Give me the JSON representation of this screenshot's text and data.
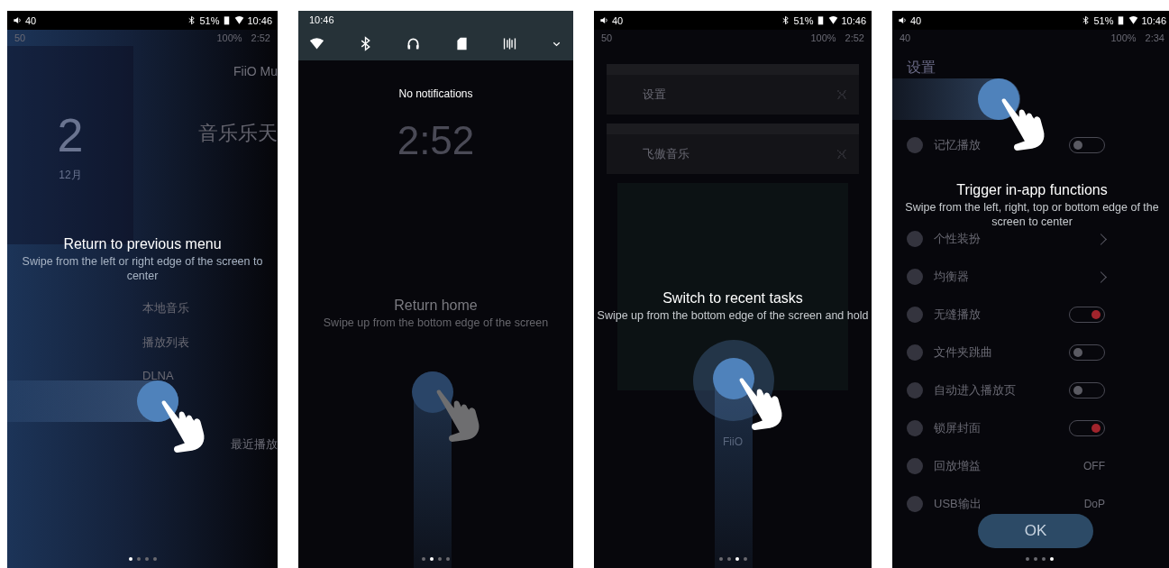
{
  "screens": [
    {
      "kind": "home",
      "status_bar": {
        "volume": "40",
        "battery": "51%",
        "time": "10:46"
      },
      "under_status": {
        "volume": "50",
        "battery": "100%",
        "time": "2:52"
      },
      "home": {
        "app_title": "FiiO Mu",
        "clock": "2",
        "date": "12月",
        "banner": "音乐乐天",
        "menu": [
          "本地音乐",
          "播放列表",
          "DLNA"
        ],
        "recent": "最近播放"
      },
      "hint": {
        "title": "Return to previous menu",
        "description": "Swipe from the left or right edge of the screen to center"
      },
      "gesture": {
        "kind": "swipe-horizontal"
      },
      "page_dots": [
        {
          "selected": true
        },
        {
          "selected": false
        },
        {
          "selected": false
        },
        {
          "selected": false
        }
      ]
    },
    {
      "kind": "notifications",
      "shade": {
        "time": "10:46",
        "toggles": [
          {
            "kind": "wifi"
          },
          {
            "kind": "bluetooth"
          },
          {
            "kind": "headphones"
          },
          {
            "kind": "sd-card"
          },
          {
            "kind": "bars"
          },
          {
            "kind": "expand"
          }
        ]
      },
      "message": "No notifications",
      "lock_clock": "2:52",
      "hint": {
        "title": "Return home",
        "description": "Swipe up from the bottom edge of the screen"
      },
      "gesture": {
        "kind": "swipe-up"
      },
      "page_dots": [
        {
          "selected": false
        },
        {
          "selected": true
        },
        {
          "selected": false
        },
        {
          "selected": false
        }
      ]
    },
    {
      "kind": "recents",
      "status_bar": {
        "volume": "40",
        "battery": "51%",
        "time": "10:46"
      },
      "under_status": {
        "volume": "50",
        "battery": "100%",
        "time": "2:52"
      },
      "tasks": [
        "设置",
        "飞傲音乐"
      ],
      "artist": "FiiO",
      "hint": {
        "title": "Switch to recent tasks",
        "description": "Swipe up from the bottom edge of the screen and hold"
      },
      "gesture": {
        "kind": "press-hold"
      },
      "page_dots": [
        {
          "selected": false
        },
        {
          "selected": false
        },
        {
          "selected": true
        },
        {
          "selected": false
        }
      ]
    },
    {
      "kind": "settings",
      "status_bar": {
        "volume": "40",
        "battery": "51%",
        "time": "10:46"
      },
      "under_status": {
        "volume": "40",
        "battery": "100%",
        "time": "2:34"
      },
      "settings_title": "设置",
      "rows": [
        {
          "label": "记忆播放",
          "kind": "toggle",
          "on": false
        },
        {
          "label": "个性装扮",
          "kind": "arrow"
        },
        {
          "label": "均衡器",
          "kind": "arrow"
        },
        {
          "label": "无缝播放",
          "kind": "toggle",
          "on": true
        },
        {
          "label": "文件夹跳曲",
          "kind": "toggle",
          "on": false
        },
        {
          "label": "自动进入播放页",
          "kind": "toggle",
          "on": false
        },
        {
          "label": "锁屏封面",
          "kind": "toggle",
          "on": true
        },
        {
          "label": "回放增益",
          "kind": "value",
          "value": "OFF"
        },
        {
          "label": "USB输出",
          "kind": "value",
          "value": "DoP"
        }
      ],
      "hint": {
        "title": "Trigger in-app functions",
        "description": "Swipe from the left, right, top or bottom edge of the screen to center"
      },
      "gesture": {
        "kind": "swipe-horizontal"
      },
      "ok_button": "OK",
      "page_dots": [
        {
          "selected": false
        },
        {
          "selected": false
        },
        {
          "selected": false
        },
        {
          "selected": true
        }
      ]
    }
  ]
}
